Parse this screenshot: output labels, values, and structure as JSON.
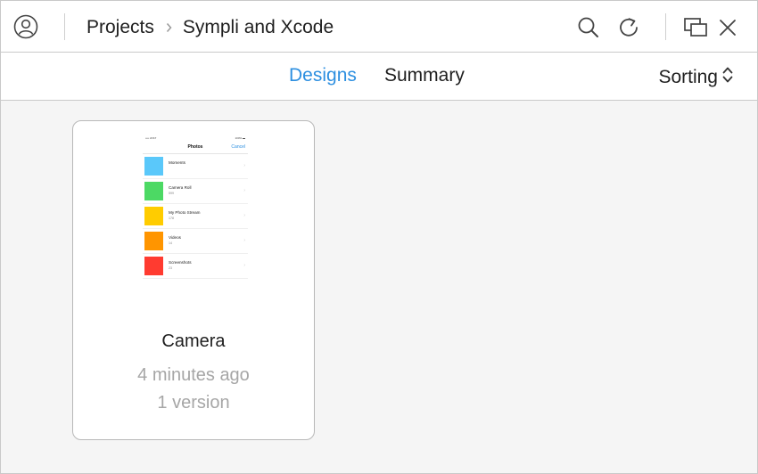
{
  "titlebar": {
    "icons": {
      "account": "account-icon",
      "search": "search-icon",
      "refresh": "refresh-icon",
      "window": "window-icon",
      "close": "close-icon"
    },
    "breadcrumb": {
      "root": "Projects",
      "separator_icon": "chevron-right-icon",
      "current": "Sympli and Xcode"
    }
  },
  "tabs": {
    "items": [
      {
        "label": "Designs",
        "active": true
      },
      {
        "label": "Summary",
        "active": false
      }
    ],
    "sorting_label": "Sorting",
    "sorting_icon": "up-down-chevron-icon"
  },
  "colors": {
    "accent": "#2d8fe0",
    "text": "#1f1f1f",
    "muted": "#a6a6a6",
    "content_bg": "#f5f5f5"
  },
  "designs": [
    {
      "name": "Camera",
      "time": "4 minutes ago",
      "versions": "1 version",
      "thumbnail": {
        "status_left": "•••• AT&T  ",
        "status_right": "100% ▬",
        "nav_title": "Photos",
        "nav_action": "Cancel",
        "rows": [
          {
            "label": "Moments",
            "count": "",
            "color": "#5ac8fa"
          },
          {
            "label": "Camera Roll",
            "count": "599",
            "color": "#4cd964"
          },
          {
            "label": "My Photo Stream",
            "count": "178",
            "color": "#ffcc00"
          },
          {
            "label": "Videos",
            "count": "14",
            "color": "#ff9500"
          },
          {
            "label": "Screenshots",
            "count": "23",
            "color": "#ff3b30"
          }
        ]
      }
    }
  ]
}
